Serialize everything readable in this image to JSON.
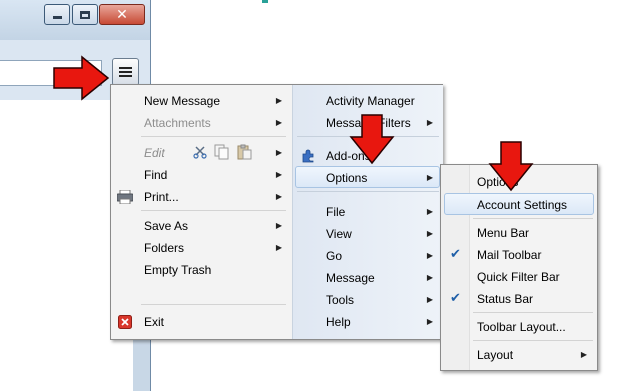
{
  "main_menu": {
    "left": [
      {
        "label": "New Message",
        "submenu": true,
        "disabled": false
      },
      {
        "label": "Attachments",
        "submenu": true,
        "disabled": true
      },
      {
        "label": "Edit",
        "submenu": true,
        "disabled": true
      },
      {
        "label": "Find",
        "submenu": true,
        "disabled": false
      },
      {
        "label": "Print...",
        "submenu": true,
        "disabled": false
      },
      {
        "label": "Save As",
        "submenu": true,
        "disabled": false
      },
      {
        "label": "Folders",
        "submenu": true,
        "disabled": false
      },
      {
        "label": "Empty Trash",
        "submenu": false,
        "disabled": false
      },
      {
        "label": "Exit",
        "submenu": false,
        "disabled": false
      }
    ],
    "right": [
      {
        "label": "Activity Manager",
        "submenu": false
      },
      {
        "label": "Message Filters",
        "submenu": true
      },
      {
        "label": "Add-ons",
        "submenu": false
      },
      {
        "label": "Options",
        "submenu": true
      },
      {
        "label": "File",
        "submenu": true
      },
      {
        "label": "View",
        "submenu": true
      },
      {
        "label": "Go",
        "submenu": true
      },
      {
        "label": "Message",
        "submenu": true
      },
      {
        "label": "Tools",
        "submenu": true
      },
      {
        "label": "Help",
        "submenu": true
      }
    ]
  },
  "options_submenu": [
    {
      "label": "Options",
      "checked": false,
      "submenu": false
    },
    {
      "label": "Account Settings",
      "checked": false,
      "submenu": false
    },
    {
      "label": "Menu Bar",
      "checked": false,
      "submenu": false
    },
    {
      "label": "Mail Toolbar",
      "checked": true,
      "submenu": false
    },
    {
      "label": "Quick Filter Bar",
      "checked": false,
      "submenu": false
    },
    {
      "label": "Status Bar",
      "checked": true,
      "submenu": false
    },
    {
      "label": "Toolbar Layout...",
      "checked": false,
      "submenu": false
    },
    {
      "label": "Layout",
      "checked": false,
      "submenu": true
    }
  ],
  "glyphs": {
    "submenu_arrow": "▶",
    "check": "✔",
    "close": "✕"
  },
  "colors": {
    "arrow_red": "#e8170f",
    "highlight_border": "#a8c4e3",
    "exit_icon": "#d9362b"
  }
}
